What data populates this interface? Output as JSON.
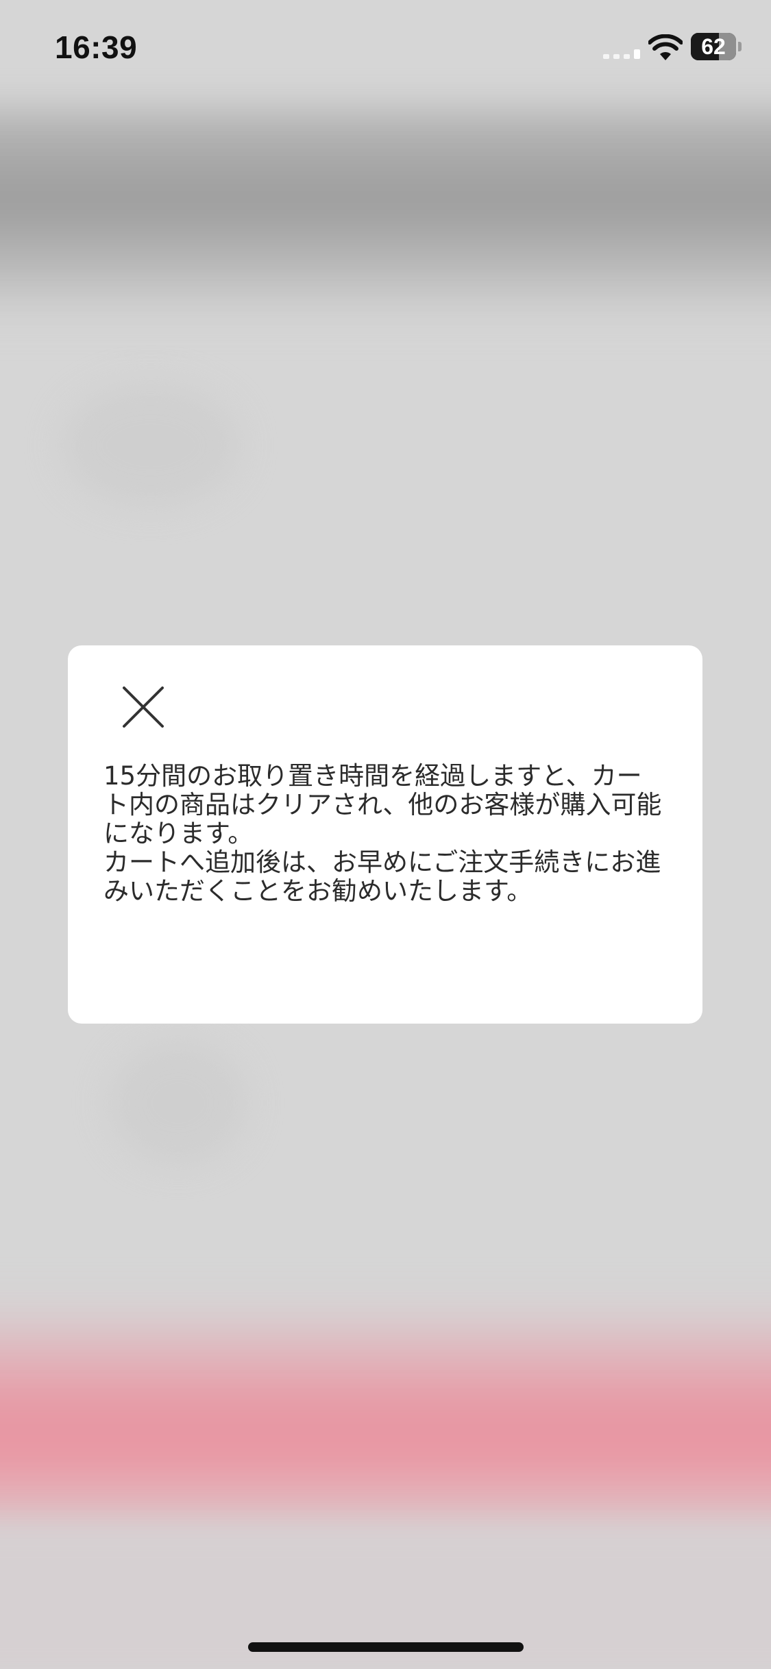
{
  "status_bar": {
    "time": "16:39",
    "battery_level": "62",
    "battery_percent": 62,
    "signal_icon": "cellular-signal-icon",
    "wifi_icon": "wifi-icon"
  },
  "modal": {
    "close_icon": "close-icon",
    "message_lines": [
      "15分間のお取り置き時間を経過しますと、カート内の商品はクリアされ、他のお客様が購入可能になります。",
      "カートへ追加後は、お早めにご注文手続きにお進みいただくことをお勧めいたします。"
    ]
  },
  "colors": {
    "overlay_background": "#d6d6d6",
    "modal_background": "#ffffff",
    "text": "#2b2b2b",
    "cta_blur": "#e8909d"
  }
}
